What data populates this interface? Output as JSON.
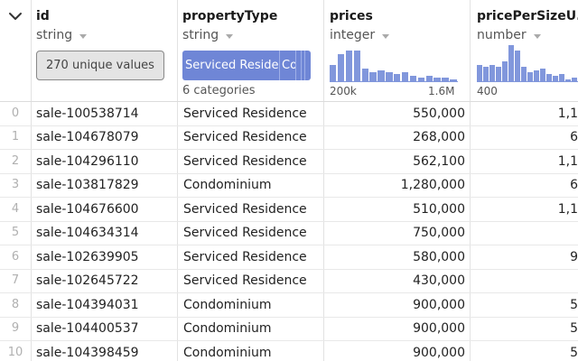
{
  "columns": [
    {
      "name": "id",
      "type": "string",
      "summary": "270 unique values"
    },
    {
      "name": "propertyType",
      "type": "string",
      "summary": "6 categories",
      "categories": [
        "Serviced Residence",
        "Co"
      ]
    },
    {
      "name": "prices",
      "type": "integer",
      "range_min": "200k",
      "range_max": "1.6M"
    },
    {
      "name": "pricePerSizeU...",
      "type": "number",
      "range_min": "400"
    }
  ],
  "histograms": {
    "prices": [
      0.45,
      0.75,
      0.85,
      0.85,
      0.35,
      0.25,
      0.3,
      0.25,
      0.2,
      0.25,
      0.15,
      0.1,
      0.15,
      0.1,
      0.1,
      0.05
    ],
    "pricePerSize": [
      0.45,
      0.4,
      0.45,
      0.4,
      0.55,
      1.0,
      0.85,
      0.4,
      0.25,
      0.3,
      0.35,
      0.2,
      0.15,
      0.2,
      0.05,
      0.1
    ]
  },
  "rows": [
    {
      "index": "0",
      "id": "sale-100538714",
      "propertyType": "Serviced Residence",
      "prices": "550,000",
      "pricePerSize": "1,1"
    },
    {
      "index": "1",
      "id": "sale-104678079",
      "propertyType": "Serviced Residence",
      "prices": "268,000",
      "pricePerSize": "6"
    },
    {
      "index": "2",
      "id": "sale-104296110",
      "propertyType": "Serviced Residence",
      "prices": "562,100",
      "pricePerSize": "1,1"
    },
    {
      "index": "3",
      "id": "sale-103817829",
      "propertyType": "Condominium",
      "prices": "1,280,000",
      "pricePerSize": "6"
    },
    {
      "index": "4",
      "id": "sale-104676600",
      "propertyType": "Serviced Residence",
      "prices": "510,000",
      "pricePerSize": "1,1"
    },
    {
      "index": "5",
      "id": "sale-104634314",
      "propertyType": "Serviced Residence",
      "prices": "750,000",
      "pricePerSize": ""
    },
    {
      "index": "6",
      "id": "sale-102639905",
      "propertyType": "Serviced Residence",
      "prices": "580,000",
      "pricePerSize": "9"
    },
    {
      "index": "7",
      "id": "sale-102645722",
      "propertyType": "Serviced Residence",
      "prices": "430,000",
      "pricePerSize": ""
    },
    {
      "index": "8",
      "id": "sale-104394031",
      "propertyType": "Condominium",
      "prices": "900,000",
      "pricePerSize": "5"
    },
    {
      "index": "9",
      "id": "sale-104400537",
      "propertyType": "Condominium",
      "prices": "900,000",
      "pricePerSize": "5"
    },
    {
      "index": "10",
      "id": "sale-104398459",
      "propertyType": "Condominium",
      "prices": "900,000",
      "pricePerSize": "5"
    }
  ],
  "colors": {
    "accent": "#6f86d6",
    "histogram": "#8197dc",
    "gridline": "#e2e2e2"
  }
}
